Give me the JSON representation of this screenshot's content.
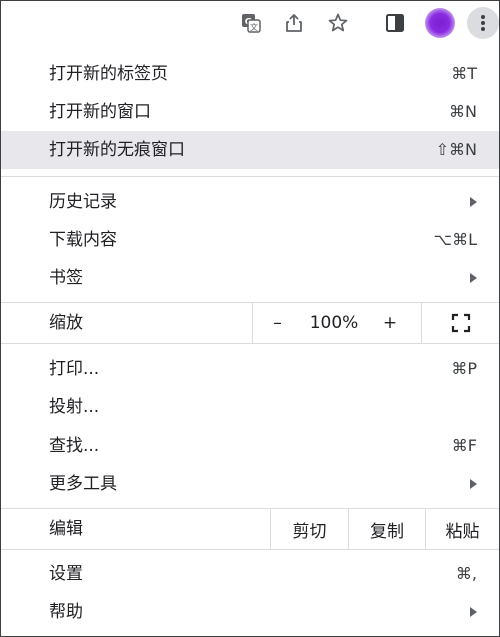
{
  "toolbar": {
    "icons": [
      "translate-icon",
      "share-icon",
      "bookmark-star-icon",
      "side-panel-icon",
      "profile-avatar",
      "more-menu-icon"
    ]
  },
  "menu": {
    "new_tab": {
      "label": "打开新的标签页",
      "shortcut": "⌘T"
    },
    "new_window": {
      "label": "打开新的窗口",
      "shortcut": "⌘N"
    },
    "new_incognito": {
      "label": "打开新的无痕窗口",
      "shortcut": "⇧⌘N"
    },
    "history": {
      "label": "历史记录"
    },
    "downloads": {
      "label": "下载内容",
      "shortcut": "⌥⌘L"
    },
    "bookmarks": {
      "label": "书签"
    },
    "zoom": {
      "label": "缩放",
      "minus": "–",
      "value": "100%",
      "plus": "+"
    },
    "print": {
      "label": "打印...",
      "shortcut": "⌘P"
    },
    "cast": {
      "label": "投射..."
    },
    "find": {
      "label": "查找...",
      "shortcut": "⌘F"
    },
    "more_tools": {
      "label": "更多工具"
    },
    "edit": {
      "label": "编辑",
      "cut": "剪切",
      "copy": "复制",
      "paste": "粘贴"
    },
    "settings": {
      "label": "设置",
      "shortcut": "⌘,"
    },
    "help": {
      "label": "帮助"
    }
  },
  "colors": {
    "highlight": "#e8e8ec",
    "avatar": "#8a2be2",
    "separator": "#dadce0"
  }
}
